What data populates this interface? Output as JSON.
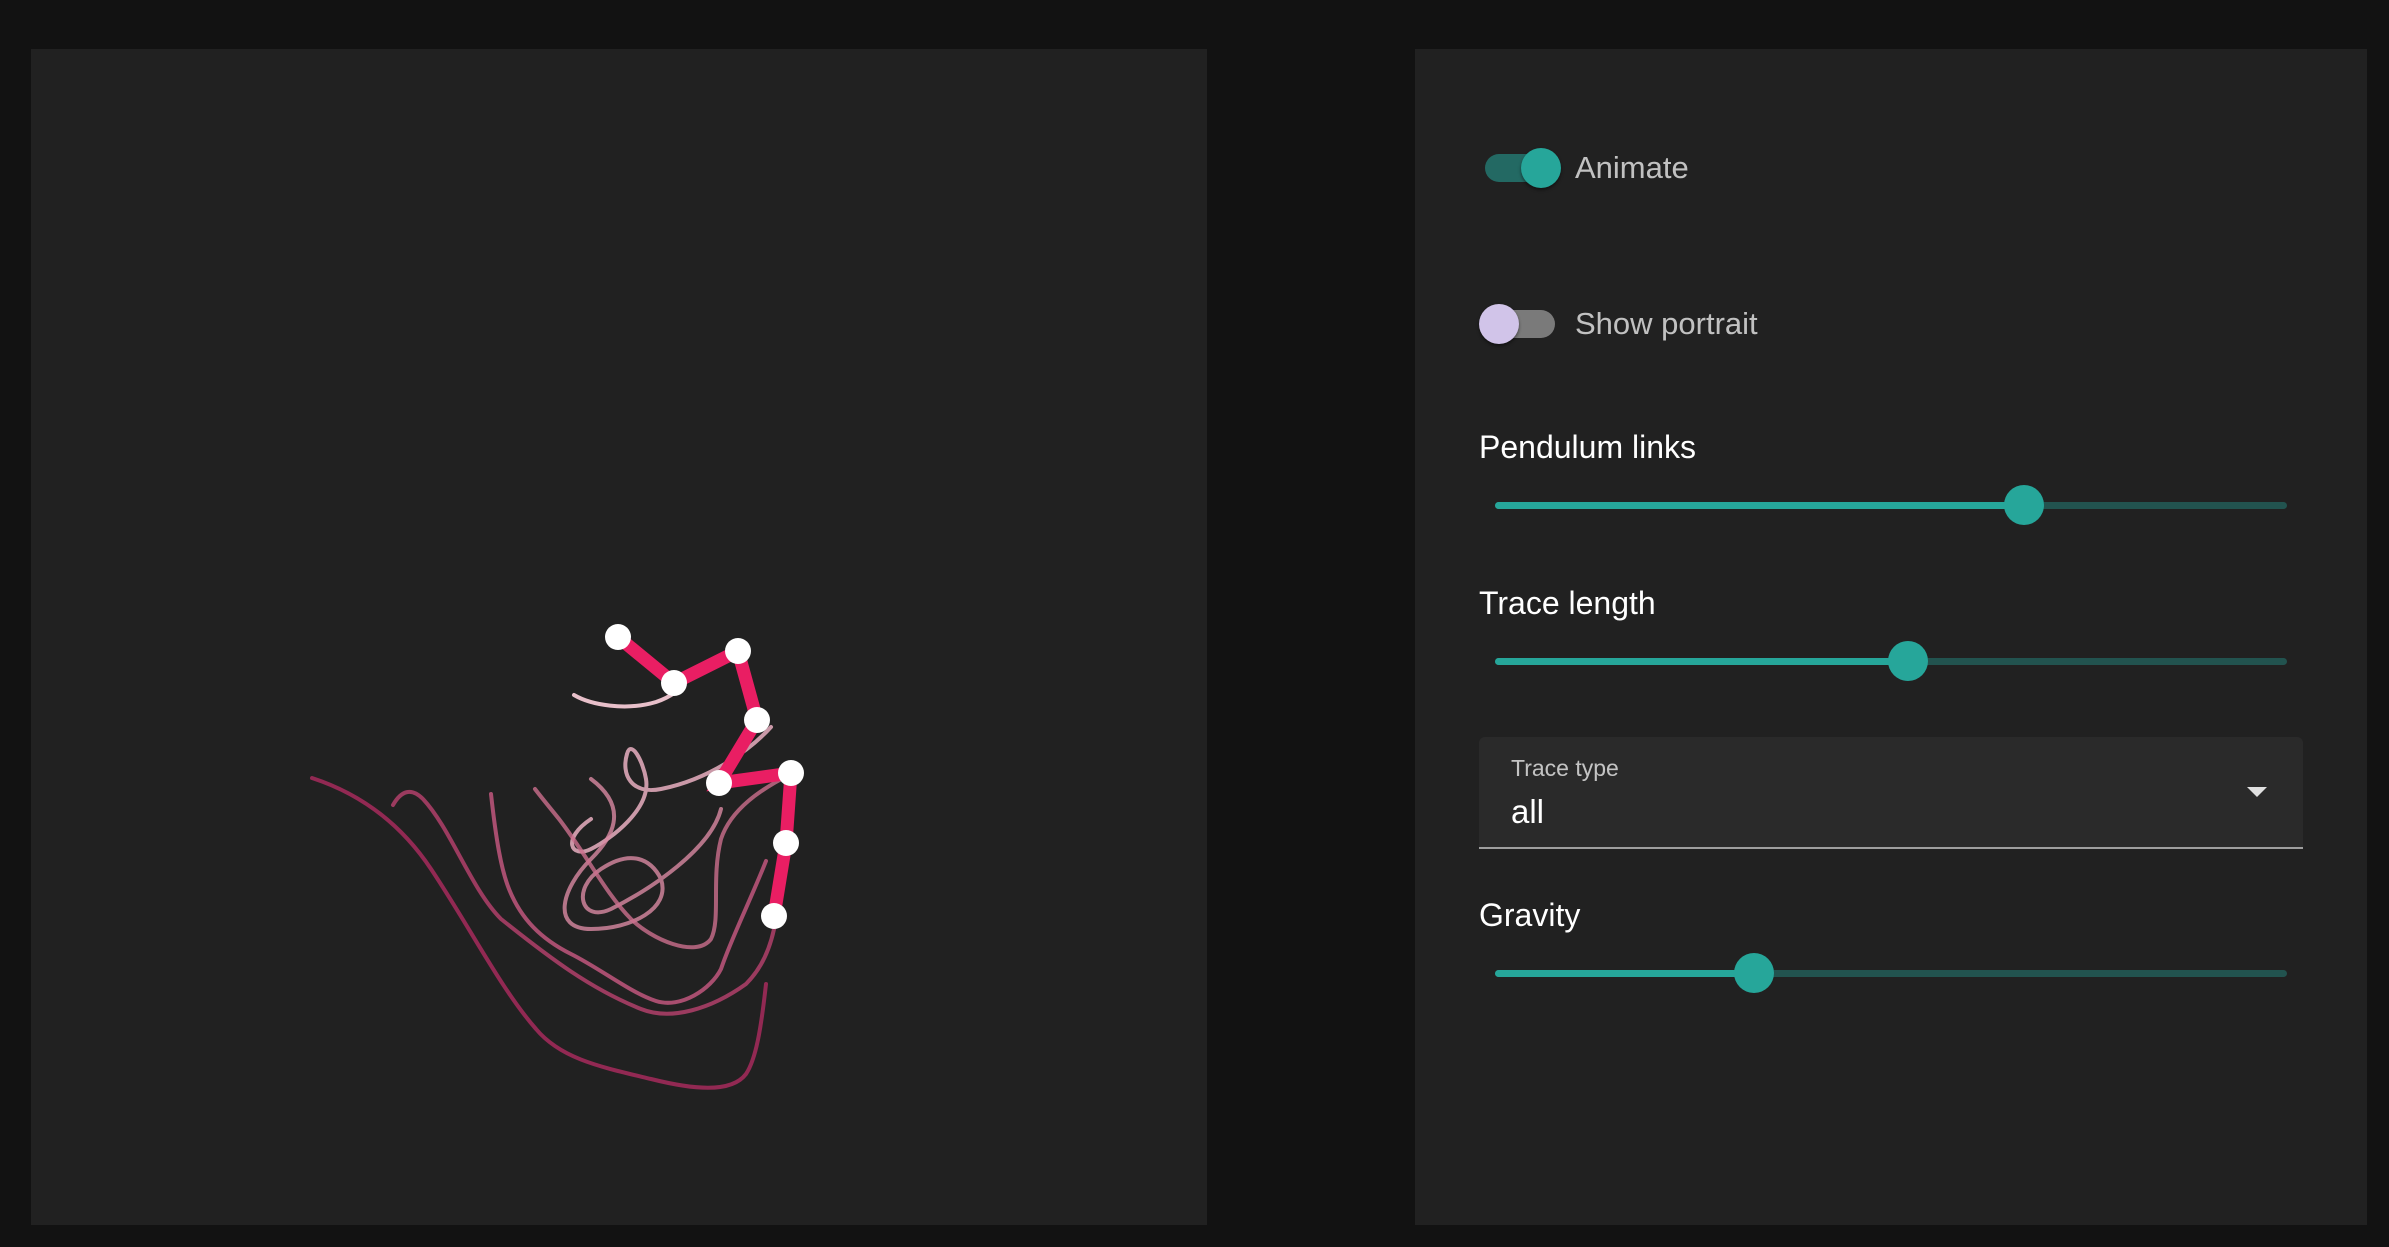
{
  "controls": {
    "animate": {
      "label": "Animate",
      "on": true
    },
    "show_portrait": {
      "label": "Show portrait",
      "on": false
    },
    "pendulum_links": {
      "label": "Pendulum links",
      "value_fraction": 0.668
    },
    "trace_length": {
      "label": "Trace length",
      "value_fraction": 0.521
    },
    "trace_type": {
      "caption": "Trace type",
      "value": "all"
    },
    "gravity": {
      "label": "Gravity",
      "value_fraction": 0.327
    }
  },
  "colors": {
    "accent": "#26a69a",
    "pendulum": "#e91e63",
    "joint": "#ffffff",
    "panel": "#212121",
    "page": "#121212"
  },
  "icons": {
    "select_arrow": "triangle-down"
  }
}
